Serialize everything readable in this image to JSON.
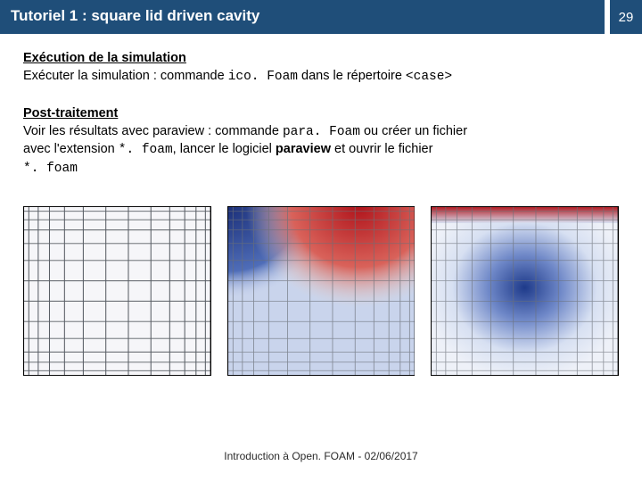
{
  "header": {
    "title": "Tutoriel 1 : square lid driven cavity",
    "page": "29"
  },
  "section1": {
    "heading": "Exécution de la simulation",
    "line_a": "Exécuter la simulation : commande ",
    "code_a": "ico. Foam",
    "line_b": " dans le répertoire ",
    "code_b": "<case>"
  },
  "section2": {
    "heading": "Post-traitement",
    "l1a": "Voir les résultats avec paraview : commande ",
    "l1code": "para. Foam",
    "l1b": "  ou créer un fichier",
    "l2a": "avec l'extension ",
    "l2code": "*. foam",
    "l2b": ", lancer le logiciel ",
    "l2bold": "paraview",
    "l2c": " et ouvrir le fichier",
    "l3code": "*. foam"
  },
  "footer": "Introduction à Open. FOAM - 02/06/2017"
}
